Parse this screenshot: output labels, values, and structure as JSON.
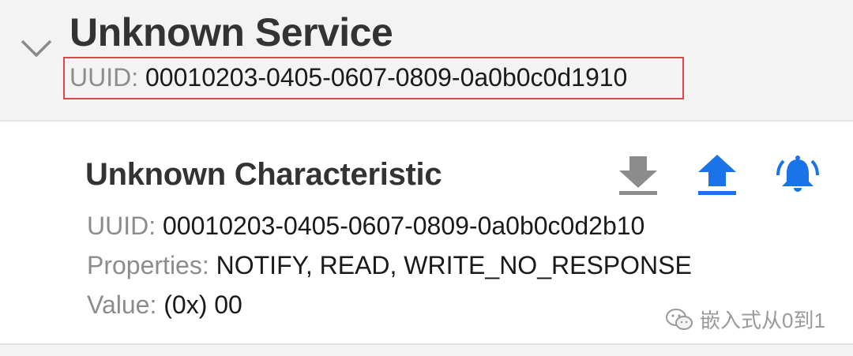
{
  "service": {
    "title": "Unknown Service",
    "uuid_label": "UUID:",
    "uuid_value": "00010203-0405-0607-0809-0a0b0c0d1910"
  },
  "characteristic": {
    "title": "Unknown Characteristic",
    "uuid_label": "UUID:",
    "uuid_value": "00010203-0405-0607-0809-0a0b0c0d2b10",
    "properties_label": "Properties:",
    "properties_value": "NOTIFY, READ, WRITE_NO_RESPONSE",
    "value_label": "Value:",
    "value_value": "(0x) 00",
    "icons": [
      "download-icon",
      "upload-icon",
      "bell-icon"
    ]
  },
  "watermark": {
    "text": "嵌入式从0到1"
  },
  "colors": {
    "accent": "#1a73e8",
    "highlight_box": "#e0454b",
    "disabled_icon": "#8c8c8c"
  }
}
